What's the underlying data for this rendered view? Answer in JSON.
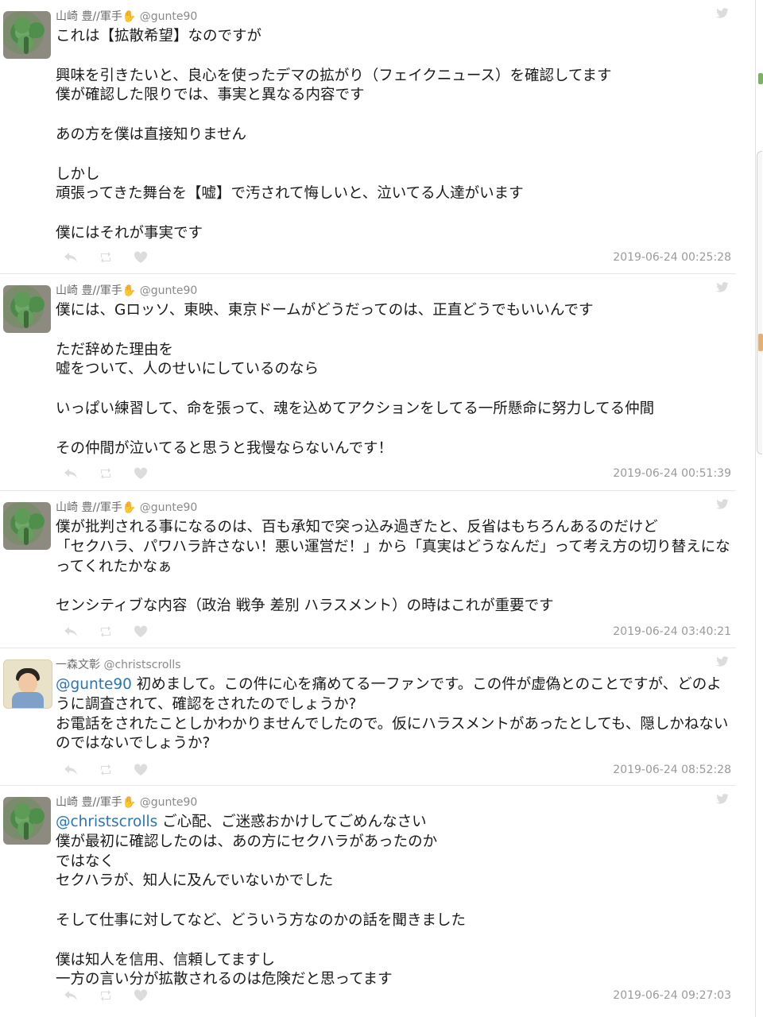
{
  "tweets": [
    {
      "author_name": "山崎 豊//軍手",
      "handle": "@gunte90",
      "mention": "",
      "text": "これは【拡散希望】なのですが\n\n興味を引きたいと、良心を使ったデマの拡がり（フェイクニュース）を確認してます\n僕が確認した限りでは、事実と異なる内容です\n\nあの方を僕は直接知りません\n\nしかし\n頑張ってきた舞台を【嘘】で汚されて悔しいと、泣いてる人達がいます\n\n僕にはそれが事実です",
      "timestamp": "2019-06-24 00:25:28"
    },
    {
      "author_name": "山崎 豊//軍手",
      "handle": "@gunte90",
      "mention": "",
      "text": "僕には、Gロッソ、東映、東京ドームがどうだってのは、正直どうでもいいんです\n\nただ辞めた理由を\n嘘をついて、人のせいにしているのなら\n\nいっぱい練習して、命を張って、魂を込めてアクションをしてる一所懸命に努力してる仲間\n\nその仲間が泣いてると思うと我慢ならないんです！",
      "timestamp": "2019-06-24 00:51:39"
    },
    {
      "author_name": "山崎 豊//軍手",
      "handle": "@gunte90",
      "mention": "",
      "text": "僕が批判される事になるのは、百も承知で突っ込み過ぎたと、反省はもちろんあるのだけど\n「セクハラ、パワハラ許さない！悪い運営だ！」から「真実はどうなんだ」って考え方の切り替えになってくれたかなぁ\n\nセンシティブな内容（政治 戦争 差別 ハラスメント）の時はこれが重要です",
      "timestamp": "2019-06-24 03:40:21"
    },
    {
      "author_name": "一森文彰",
      "handle": "@christscrolls",
      "mention": "@gunte90",
      "text": " 初めまして。この件に心を痛めてる一ファンです。この件が虚偽とのことですが、どのように調査されて、確認をされたのでしょうか?\nお電話をされたことしかわかりませんでしたので。仮にハラスメントがあったとしても、隠しかねないのではないでしょうか?",
      "timestamp": "2019-06-24 08:52:28"
    },
    {
      "author_name": "山崎 豊//軍手",
      "handle": "@gunte90",
      "mention": "@christscrolls",
      "text": " ご心配、ご迷惑おかけしてごめんなさい\n僕が最初に確認したのは、あの方にセクハラがあったのか\nではなく\nセクハラが、知人に及んでいないかでした\n\nそして仕事に対してなど、どういう方なのかの話を聞きました\n\n僕は知人を信用、信頼してますし\n一方の言い分が拡散されるのは危険だと思ってます",
      "timestamp": "2019-06-24 09:27:03"
    }
  ],
  "icons": {
    "avatar_main": "clover-avatar",
    "avatar_reply": "child-portrait-avatar",
    "platform": "twitter-bird-icon",
    "actions": [
      "reply-icon",
      "retweet-icon",
      "like-icon"
    ],
    "name_suffix": "raised-hand-emoji"
  },
  "colors": {
    "mention": "#2b74b8",
    "meta_gray": "#9a9a9a",
    "hand_emoji": "#f4b400"
  }
}
